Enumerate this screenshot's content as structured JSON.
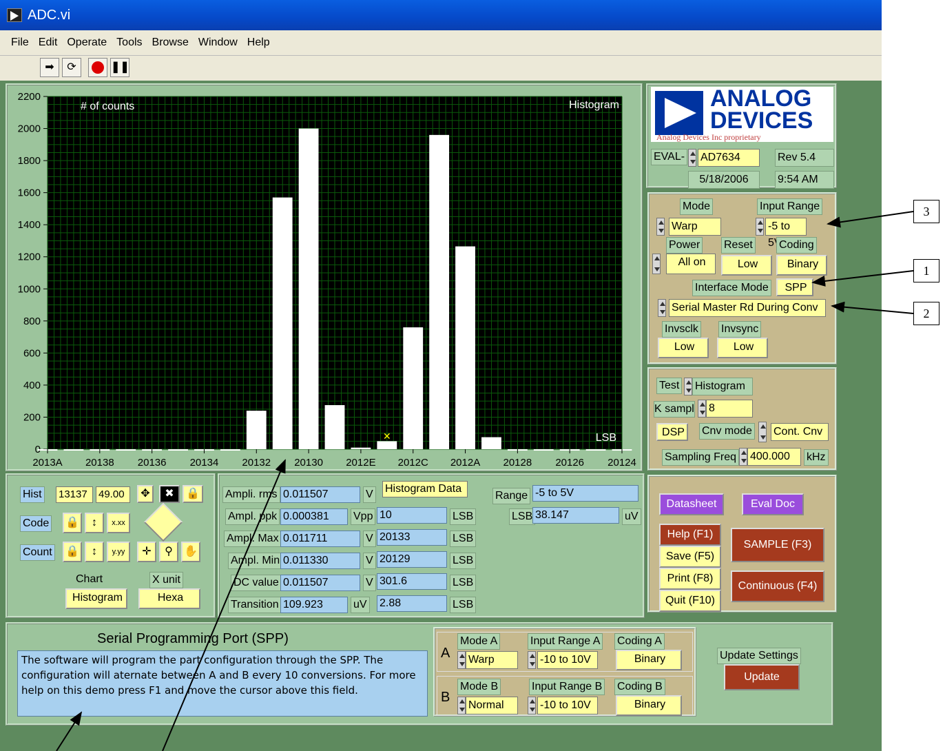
{
  "window": {
    "title": "ADC.vi"
  },
  "menu": [
    "File",
    "Edit",
    "Operate",
    "Tools",
    "Browse",
    "Window",
    "Help"
  ],
  "chart_data": {
    "type": "bar",
    "title": "Histogram",
    "ylabel": "# of counts",
    "xlabel": "LSB",
    "categories": [
      "2013A",
      "20139",
      "20138",
      "20137",
      "20136",
      "20135",
      "20134",
      "20133",
      "20132",
      "20131",
      "20130",
      "2012F",
      "2012E",
      "2012D",
      "2012C",
      "2012B",
      "2012A",
      "20129",
      "20128",
      "20127",
      "20126",
      "20125",
      "20124"
    ],
    "tick_labels": [
      "2013A",
      "20138",
      "20136",
      "20134",
      "20132",
      "20130",
      "2012E",
      "2012C",
      "2012A",
      "20128",
      "20126",
      "20124"
    ],
    "values": [
      0,
      0,
      0,
      0,
      0,
      0,
      0,
      0,
      240,
      1570,
      2000,
      275,
      10,
      50,
      760,
      1960,
      1265,
      75,
      0,
      0,
      0,
      0,
      0
    ],
    "ylim": [
      0,
      2200
    ],
    "yticks": [
      0,
      200,
      400,
      600,
      800,
      1000,
      1200,
      1400,
      1600,
      1800,
      2000,
      2200
    ],
    "grid": true
  },
  "logo": {
    "line1": "ANALOG",
    "line2": "DEVICES",
    "sub": "Analog Devices Inc proprietary"
  },
  "header": {
    "eval_label": "EVAL-",
    "part": "AD7634",
    "rev": "Rev 5.4",
    "date": "5/18/2006",
    "time": "9:54 AM"
  },
  "config": {
    "mode_label": "Mode",
    "mode": "Warp",
    "input_range_label": "Input Range",
    "input_range": "-5 to 5V",
    "power_label": "Power",
    "power": "All on",
    "reset_label": "Reset",
    "reset": "Low",
    "coding_label": "Coding",
    "coding": "Binary",
    "interface_mode_label": "Interface Mode",
    "interface_mode": "SPP",
    "serial_mode": "Serial Master Rd During Conv",
    "invsclk_label": "Invsclk",
    "invsclk": "Low",
    "invsync_label": "Invsync",
    "invsync": "Low"
  },
  "test": {
    "test_label": "Test",
    "test": "Histogram",
    "ksampl_label": "K sampl",
    "ksampl": "8",
    "dsp": "DSP",
    "cnv_mode_label": "Cnv mode",
    "cnv_mode": "Cont. Cnv",
    "freq_label": "Sampling Freq",
    "freq": "400.000",
    "freq_unit": "kHz"
  },
  "buttons": {
    "datasheet": "Datasheet",
    "evaldoc": "Eval Doc",
    "help": "Help (F1)",
    "save": "Save (F5)",
    "print": "Print (F8)",
    "quit": "Quit (F10)",
    "sample": "SAMPLE (F3)",
    "continuous": "Continuous (F4)"
  },
  "cursor": {
    "hist": "Hist",
    "hist_x": "13137",
    "hist_y": "49.00",
    "code": "Code",
    "count": "Count",
    "chart_label": "Chart",
    "chart": "Histogram",
    "xunit_label": "X unit",
    "xunit": "Hexa"
  },
  "stats": {
    "rms_label": "Ampli. rms",
    "rms": "0.011507",
    "rms_unit": "V",
    "ppk_label": "Ampl. ppk",
    "ppk": "0.000381",
    "ppk_unit": "Vpp",
    "max_label": "Ampl. Max",
    "max": "0.011711",
    "max_unit": "V",
    "min_label": "Ampl. Min",
    "min": "0.011330",
    "min_unit": "V",
    "dc_label": "DC value",
    "dc": "0.011507",
    "dc_unit": "V",
    "trans_label": "Transition",
    "trans": "109.923",
    "trans_unit": "uV",
    "hist_data_label": "Histogram Data",
    "d": "10",
    "xmax": "20133",
    "xmin": "20129",
    "c4": "301.6",
    "c5": "2.88",
    "lsb": "LSB",
    "range_label": "Range",
    "range": "-5 to 5V",
    "lsb_label": "LSB",
    "lsb_val": "38.147",
    "lsb_unit": "uV"
  },
  "info": {
    "title": "Serial Programming Port (SPP)",
    "text": "The software will program the part configuration through the SPP. The configuration will aternate between A and B every 10 conversions. For more help on this demo press F1 and move the cursor above this field."
  },
  "channels": {
    "a": "A",
    "b": "B",
    "mode_a_label": "Mode A",
    "mode_a": "Warp",
    "range_a_label": "Input Range A",
    "range_a": "-10 to 10V",
    "coding_a_label": "Coding A",
    "coding_a": "Binary",
    "mode_b_label": "Mode B",
    "mode_b": "Normal",
    "range_b_label": "Input Range B",
    "range_b": "-10 to 10V",
    "coding_b_label": "Coding B",
    "coding_b": "Binary",
    "update_label": "Update Settings",
    "update": "Update"
  },
  "callouts": [
    "3",
    "1",
    "2"
  ]
}
